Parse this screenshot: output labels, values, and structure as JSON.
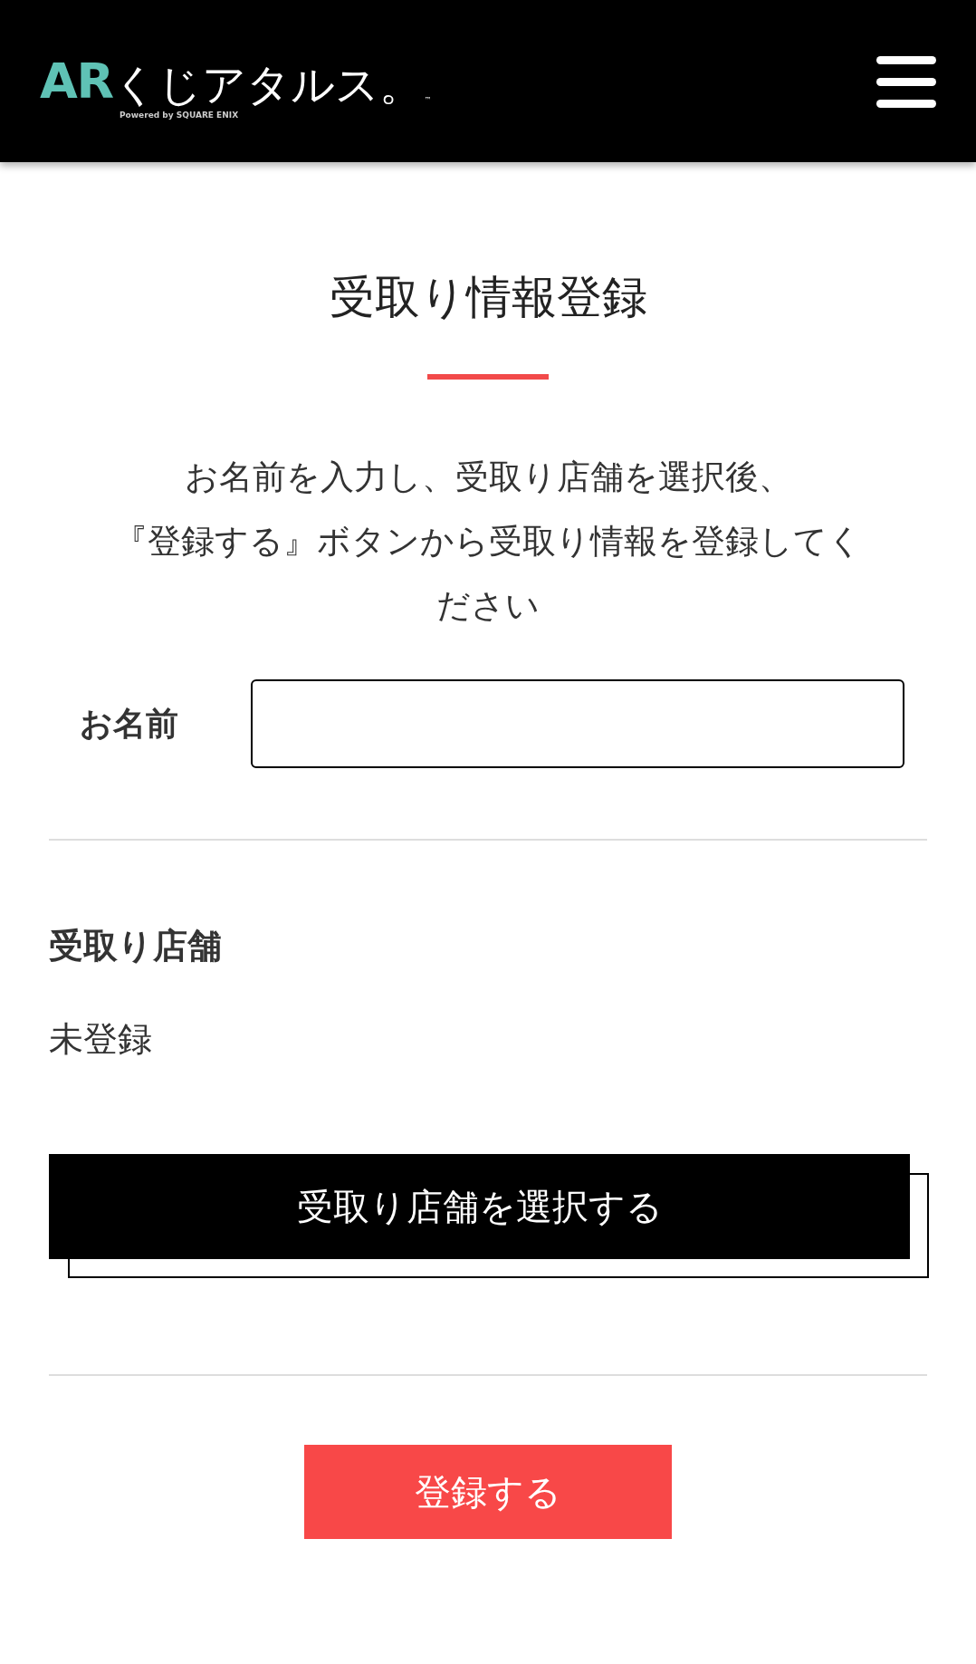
{
  "header": {
    "logo": {
      "mark": "AR",
      "name": "くじアタルス。",
      "trademark": "™",
      "tagline": "Powered by SQUARE ENIX"
    }
  },
  "title": "受取り情報登録",
  "instructions": [
    "お名前を入力し、受取り店舗を選択後、",
    "『登録する』ボタンから受取り情報を登録してく",
    "ださい"
  ],
  "name_field": {
    "label": "お名前"
  },
  "store": {
    "label": "受取り店舗",
    "value": "未登録",
    "button": "受取り店舗を選択する"
  },
  "submit": "登録する"
}
